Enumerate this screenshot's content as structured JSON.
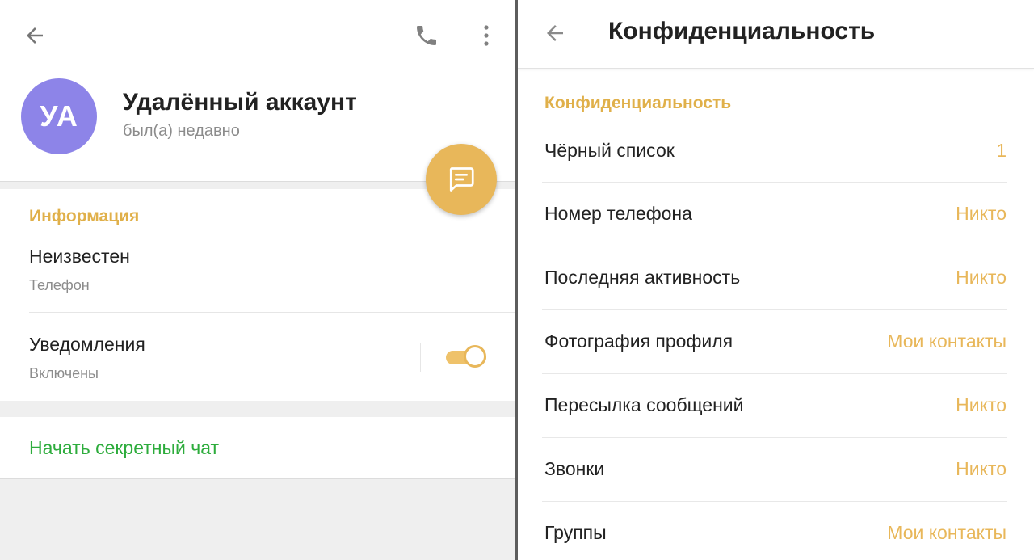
{
  "profile": {
    "avatar_initials": "УА",
    "avatar_color": "#8d84e8",
    "name": "Удалённый аккаунт",
    "status": "был(а) недавно"
  },
  "info": {
    "section_title": "Информация",
    "phone_value": "Неизвестен",
    "phone_label": "Телефон",
    "notifications_title": "Уведомления",
    "notifications_state": "Включены",
    "notifications_enabled": true
  },
  "secret_chat_label": "Начать секретный чат",
  "privacy": {
    "title": "Конфиденциальность",
    "section_title": "Конфиденциальность",
    "rows": [
      {
        "label": "Чёрный список",
        "value": "1"
      },
      {
        "label": "Номер телефона",
        "value": "Никто"
      },
      {
        "label": "Последняя активность",
        "value": "Никто"
      },
      {
        "label": "Фотография профиля",
        "value": "Мои контакты"
      },
      {
        "label": "Пересылка сообщений",
        "value": "Никто"
      },
      {
        "label": "Звонки",
        "value": "Никто"
      },
      {
        "label": "Группы",
        "value": "Мои контакты"
      }
    ]
  },
  "colors": {
    "accent": "#e8b75a",
    "secret_chat": "#2dac3c"
  },
  "icons": [
    "back-arrow-icon",
    "phone-icon",
    "more-vertical-icon",
    "message-icon"
  ]
}
